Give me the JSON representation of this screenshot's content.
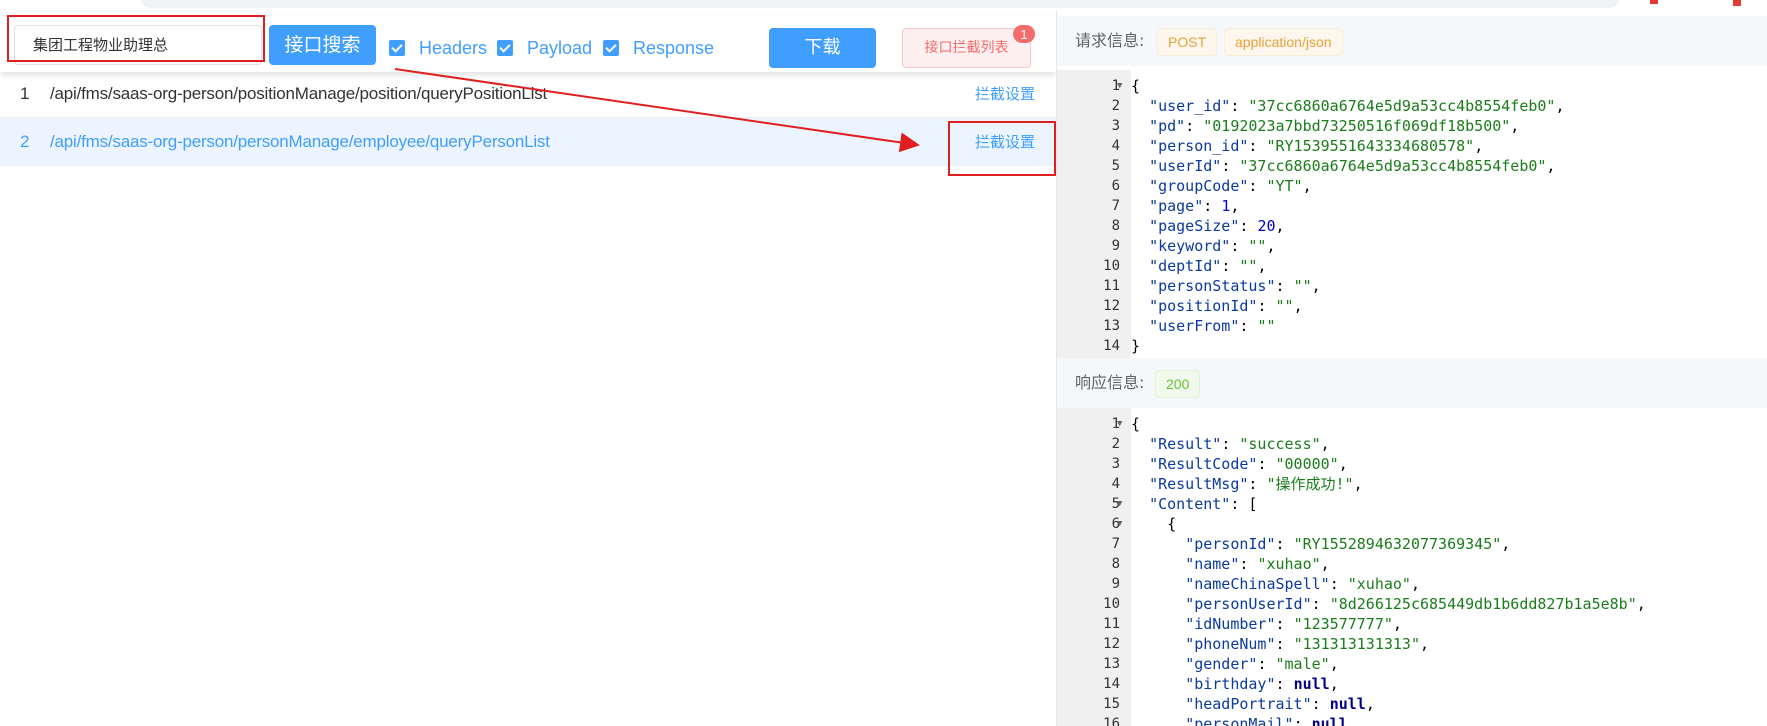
{
  "toolbar": {
    "search_value": "集团工程物业助理总",
    "search_button": "接口搜索",
    "checkboxes": [
      "Headers",
      "Payload",
      "Response"
    ],
    "download_button": "下载",
    "intercept_list_button": "接口拦截列表",
    "intercept_badge": "1"
  },
  "requests": [
    {
      "index": "1",
      "path": "/api/fms/saas-org-person/positionManage/position/queryPositionList",
      "action": "拦截设置"
    },
    {
      "index": "2",
      "path": "/api/fms/saas-org-person/personManage/employee/queryPersonList",
      "action": "拦截设置"
    }
  ],
  "request_info": {
    "label": "请求信息:",
    "method": "POST",
    "content_type": "application/json",
    "lines": [
      "{",
      "  \"user_id\": \"37cc6860a6764e5d9a53cc4b8554feb0\",",
      "  \"pd\": \"0192023a7bbd73250516f069df18b500\",",
      "  \"person_id\": \"RY1539551643334680578\",",
      "  \"userId\": \"37cc6860a6764e5d9a53cc4b8554feb0\",",
      "  \"groupCode\": \"YT\",",
      "  \"page\": 1,",
      "  \"pageSize\": 20,",
      "  \"keyword\": \"\",",
      "  \"deptId\": \"\",",
      "  \"personStatus\": \"\",",
      "  \"positionId\": \"\",",
      "  \"userFrom\": \"\"",
      "}"
    ]
  },
  "response_info": {
    "label": "响应信息:",
    "status": "200",
    "lines": [
      "{",
      "  \"Result\": \"success\",",
      "  \"ResultCode\": \"00000\",",
      "  \"ResultMsg\": \"操作成功!\",",
      "  \"Content\": [",
      "    {",
      "      \"personId\": \"RY1552894632077369345\",",
      "      \"name\": \"xuhao\",",
      "      \"nameChinaSpell\": \"xuhao\",",
      "      \"personUserId\": \"8d266125c685449db1b6dd827b1a5e8b\",",
      "      \"idNumber\": \"123577777\",",
      "      \"phoneNum\": \"131313131313\",",
      "      \"gender\": \"male\",",
      "      \"birthday\": null,",
      "      \"headPortrait\": null,",
      "      \"personMail\": null,"
    ]
  },
  "colors": {
    "accent": "#409eff",
    "danger": "#f56c6c",
    "annotation": "#e02020"
  }
}
